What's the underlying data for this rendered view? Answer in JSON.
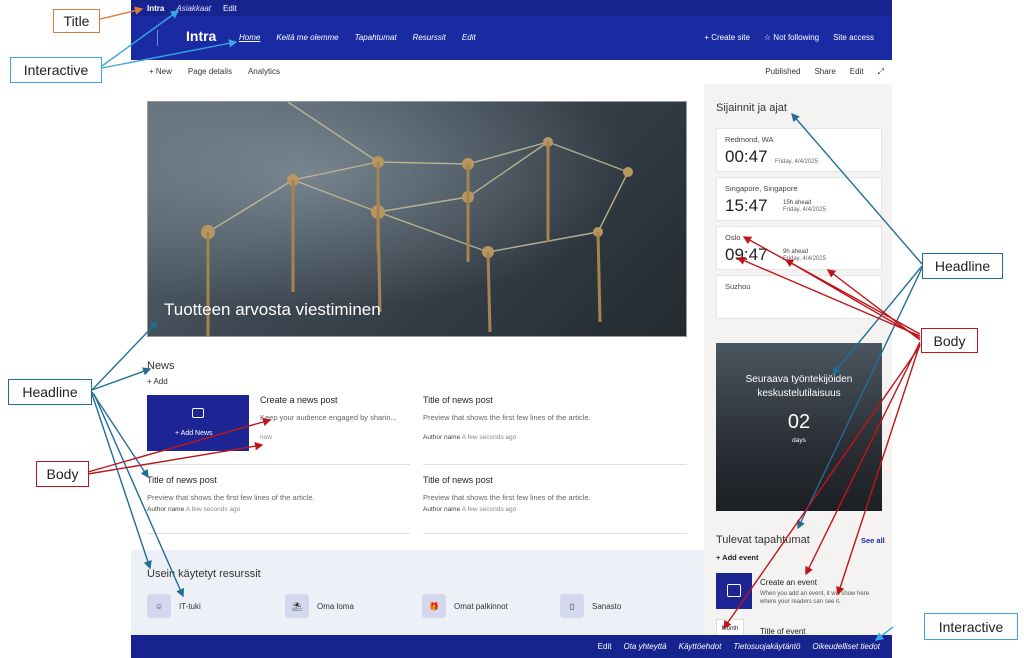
{
  "topbar": {
    "brand": "Intra",
    "links": [
      "Asiakkaat",
      "Edit"
    ]
  },
  "header": {
    "site_title": "Intra",
    "nav": [
      "Home",
      "Keitä me olemme",
      "Tapahtumat",
      "Resurssit",
      "Edit"
    ],
    "actions": {
      "create_site": "+ Create site",
      "follow": "☆ Not following",
      "access": "Site access"
    }
  },
  "command_bar": {
    "new": "+ New",
    "page_details": "Page details",
    "analytics": "Analytics",
    "published": "Published",
    "share": "Share",
    "edit": "Edit"
  },
  "hero": {
    "title": "Tuotteen arvosta viestiminen"
  },
  "news": {
    "heading": "News",
    "add": "+ Add",
    "add_card_label": "+ Add News",
    "posts": [
      {
        "title": "Create a news post",
        "preview": "Keep your audience engaged by sharin...",
        "author": "",
        "time": "now"
      },
      {
        "title": "Title of news post",
        "preview": "Preview that shows the first few lines of the article.",
        "author": "Author name",
        "time": "A few seconds ago"
      },
      {
        "title": "Title of news post",
        "preview": "Preview that shows the first few lines of the article.",
        "author": "Author name",
        "time": "A few seconds ago"
      },
      {
        "title": "Title of news post",
        "preview": "Preview that shows the first few lines of the article.",
        "author": "Author name",
        "time": "A few seconds ago"
      }
    ]
  },
  "resources": {
    "heading": "Usein käytetyt resurssit",
    "items": [
      "IT-tuki",
      "Oma loma",
      "Omat palkinnot",
      "Sanasto"
    ]
  },
  "sidebar": {
    "clocks_heading": "Sijainnit ja ajat",
    "clocks": [
      {
        "city": "Redmond, WA",
        "time": "00:47",
        "ahead": "",
        "date": "Friday, 4/4/2025"
      },
      {
        "city": "Singapore, Singapore",
        "time": "15:47",
        "ahead": "15h ahead",
        "date": "Friday, 4/4/2025"
      },
      {
        "city": "Oslo",
        "time": "09:47",
        "ahead": "9h ahead",
        "date": "Friday, 4/4/2025"
      },
      {
        "city": "Suzhou",
        "time": "",
        "ahead": "",
        "date": ""
      }
    ],
    "countdown": {
      "message": "Seuraava työntekijöiden keskustelutilaisuus",
      "number": "02",
      "unit": "days"
    },
    "events": {
      "heading": "Tulevat tapahtumat",
      "see_all": "See all",
      "add": "+ Add event",
      "create_title": "Create an event",
      "create_text": "When you add an event, it will show here where your readers can see it.",
      "month": "Month",
      "title2": "Title of event"
    }
  },
  "footer": [
    "Edit",
    "Ota yhteyttä",
    "Käyttöehdot",
    "Tietosuojakäytäntö",
    "Oikeudelliset tiedot"
  ],
  "annotations": {
    "title": "Title",
    "interactive_top": "Interactive",
    "headline_left": "Headline",
    "body_left": "Body",
    "headline_right": "Headline",
    "body_right": "Body",
    "interactive_bottom": "Interactive"
  },
  "colors": {
    "brand": "#1a2aa3",
    "title_ann": "#e07a3a",
    "interactive_ann": "#38a8e0",
    "headline_ann": "#206e97",
    "body_ann": "#c0141a"
  }
}
